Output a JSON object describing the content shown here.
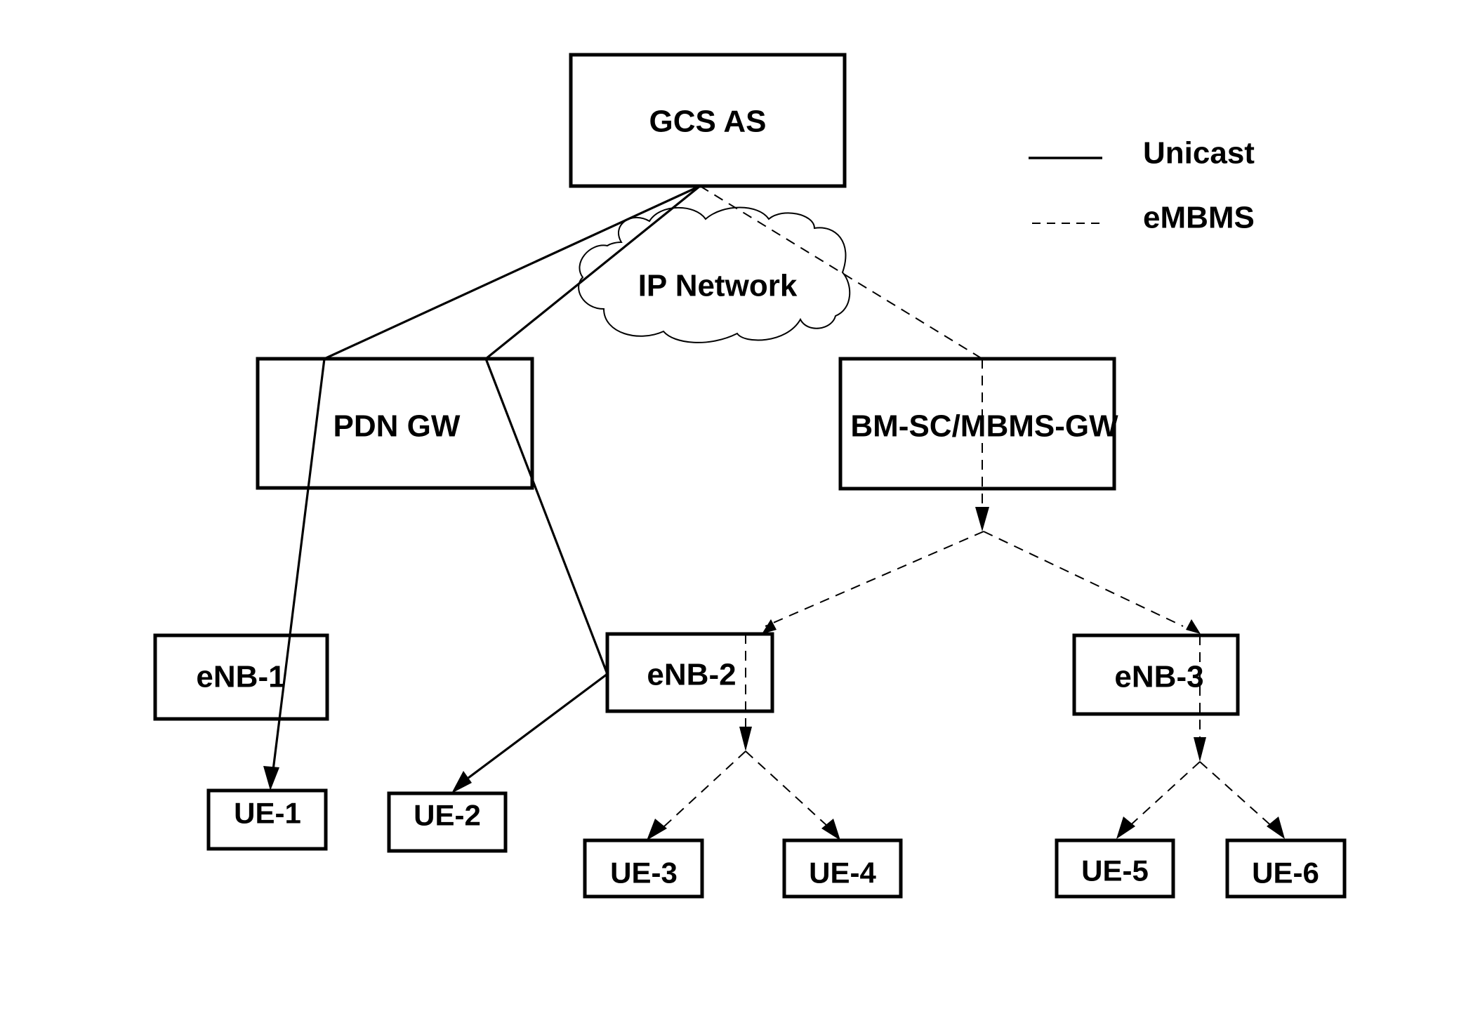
{
  "diagram": {
    "nodes": {
      "gcs_as": "GCS AS",
      "ip_network": "IP Network",
      "pdn_gw": "PDN GW",
      "bmsc_mbms_gw": "BM-SC/MBMS-GW",
      "enb1": "eNB-1",
      "enb2": "eNB-2",
      "enb3": "eNB-3",
      "ue1": "UE-1",
      "ue2": "UE-2",
      "ue3": "UE-3",
      "ue4": "UE-4",
      "ue5": "UE-5",
      "ue6": "UE-6"
    },
    "legend": {
      "unicast": "Unicast",
      "embms": "eMBMS"
    },
    "edges": [
      {
        "from": "GCS AS",
        "to": "PDN GW",
        "type": "Unicast"
      },
      {
        "from": "GCS AS",
        "to": "PDN GW",
        "type": "Unicast"
      },
      {
        "from": "PDN GW",
        "to": "UE-1",
        "type": "Unicast"
      },
      {
        "from": "PDN GW",
        "to": "eNB-2",
        "type": "Unicast"
      },
      {
        "from": "eNB-2",
        "to": "UE-2",
        "type": "Unicast"
      },
      {
        "from": "GCS AS",
        "to": "BM-SC/MBMS-GW",
        "type": "eMBMS"
      },
      {
        "from": "BM-SC/MBMS-GW",
        "to": "eNB-2",
        "type": "eMBMS"
      },
      {
        "from": "BM-SC/MBMS-GW",
        "to": "eNB-3",
        "type": "eMBMS"
      },
      {
        "from": "eNB-2",
        "to": "UE-3",
        "type": "eMBMS"
      },
      {
        "from": "eNB-2",
        "to": "UE-4",
        "type": "eMBMS"
      },
      {
        "from": "eNB-3",
        "to": "UE-5",
        "type": "eMBMS"
      },
      {
        "from": "eNB-3",
        "to": "UE-6",
        "type": "eMBMS"
      }
    ]
  }
}
